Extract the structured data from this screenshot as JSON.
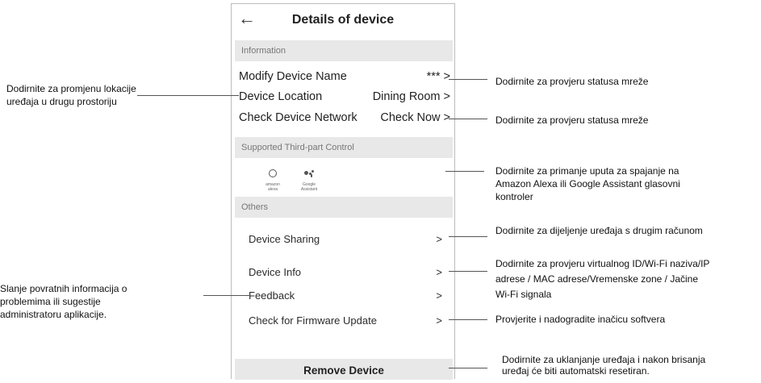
{
  "header": {
    "back_glyph": "←",
    "title": "Details of device"
  },
  "information": {
    "header": "Information",
    "rows": [
      {
        "label": "Modify Device Name",
        "value": "*** >"
      },
      {
        "label": "Device Location",
        "value": "Dining Room >"
      },
      {
        "label": "Check Device Network",
        "value": "Check Now >"
      }
    ]
  },
  "third_party": {
    "header": "Supported Third-part Control",
    "items": [
      {
        "icon": "amazon-alexa-icon",
        "caption": "amazon alexa"
      },
      {
        "icon": "google-assistant-icon",
        "caption": "Google Assistant"
      }
    ]
  },
  "others": {
    "header": "Others",
    "rows": [
      {
        "label": "Device Sharing",
        "chevron": ">"
      },
      {
        "label": "Device Info",
        "chevron": ">"
      },
      {
        "label": "Feedback",
        "chevron": ">"
      },
      {
        "label": "Check for Firmware Update",
        "chevron": ">"
      }
    ]
  },
  "remove_label": "Remove Device",
  "callouts": {
    "left_location": [
      "Dodirnite za promjenu lokacije",
      "uređaja u drugu prostoriju"
    ],
    "left_feedback": [
      "Slanje povratnih informacija o",
      "problemima ili sugestije",
      "administratoru aplikacije."
    ],
    "right_name": [
      "Dodirnite za provjeru statusa mreže"
    ],
    "right_network": [
      "Dodirnite za provjeru statusa mreže"
    ],
    "right_third_party": [
      "Dodirnite za primanje uputa za spajanje na",
      "Amazon Alexa ili Google Assistant glasovni",
      "kontroler"
    ],
    "right_sharing": [
      "Dodirnite za dijeljenje uređaja s drugim računom"
    ],
    "right_info": [
      "Dodirnite za provjeru virtualnog ID/Wi-Fi naziva/IP",
      "adrese / MAC adrese/Vremenske zone / Jačine",
      "Wi-Fi signala"
    ],
    "right_firmware": [
      "Provjerite i nadogradite inačicu softvera"
    ],
    "right_remove": [
      "Dodirnite za uklanjanje uređaja i nakon brisanja",
      "uređaj će biti automatski resetiran."
    ]
  },
  "colors": {
    "section_bg": "#e8e8e8",
    "section_text": "#777777",
    "border": "#bcbcbc"
  }
}
